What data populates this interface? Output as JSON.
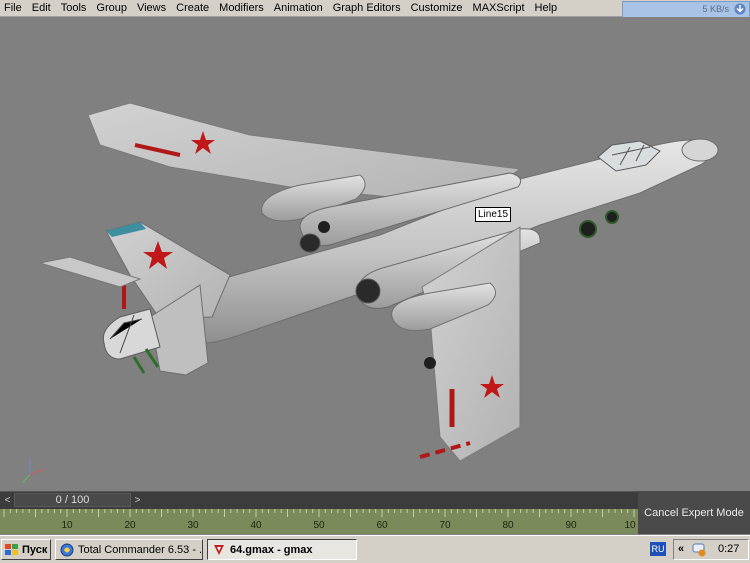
{
  "menu": {
    "items": [
      "File",
      "Edit",
      "Tools",
      "Group",
      "Views",
      "Create",
      "Modifiers",
      "Animation",
      "Graph Editors",
      "Customize",
      "MAXScript",
      "Help"
    ]
  },
  "network_widget": {
    "speed": "5 KB/s"
  },
  "viewport": {
    "selected_object_label": "Line15"
  },
  "timeslider": {
    "frame": "0 / 100",
    "prev_label": "<",
    "next_label": ">"
  },
  "trackbar": {
    "tick_labels": [
      "10",
      "20",
      "30",
      "40",
      "50",
      "60",
      "70",
      "80",
      "90",
      "10"
    ]
  },
  "expert_mode": {
    "cancel_label": "Cancel Expert Mode"
  },
  "taskbar": {
    "start_label": "Пуск",
    "tasks": [
      "Total Commander 6.53 - ...",
      "64.gmax - gmax"
    ],
    "language": "RU",
    "tray_chevron": "«",
    "clock": "0:27"
  },
  "colors": {
    "viewport_bg": "#808080",
    "trackbar_bg": "#7a8a5a",
    "aircraft_body": "#c9c9c9",
    "star_red": "#c01818"
  }
}
